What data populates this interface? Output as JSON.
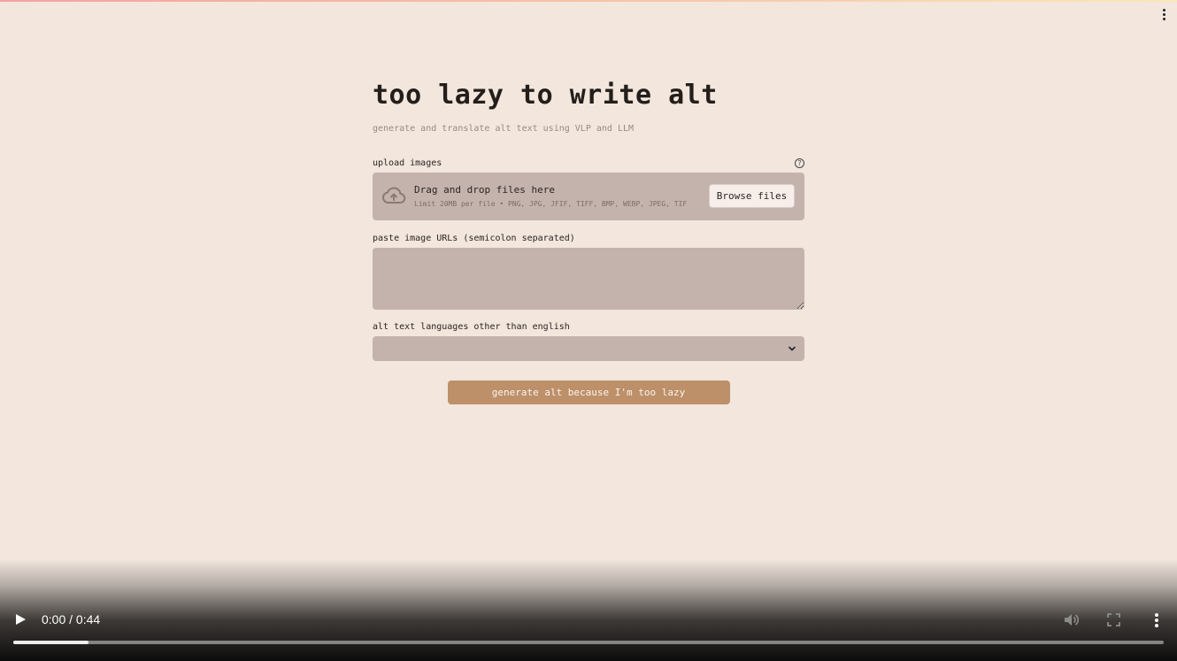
{
  "app": {
    "title": "too lazy to write alt",
    "subtitle": "generate and translate alt text using VLP and LLM"
  },
  "upload": {
    "label": "upload images",
    "help_icon": "help-circle-icon",
    "help_glyph": "?",
    "dropzone_title": "Drag and drop files here",
    "dropzone_limit": "Limit 20MB per file • PNG, JPG, JFIF, TIFF, BMP, WEBP, JPEG, TIF",
    "browse_label": "Browse files",
    "upload_icon": "cloud-upload-icon"
  },
  "urls": {
    "label": "paste image URLs (semicolon separated)",
    "value": ""
  },
  "languages": {
    "label": "alt text languages other than english",
    "selected": "",
    "chevron_icon": "chevron-down-icon"
  },
  "generate_button": {
    "label": "generate alt because I'm too lazy"
  },
  "video_player": {
    "time": "0:00 / 0:44",
    "progress_buffered_fraction": 0.065,
    "progress_played_fraction": 0,
    "icons": [
      "play-icon",
      "volume-icon",
      "fullscreen-icon",
      "more-vert-icon"
    ]
  },
  "colors": {
    "background": "#f2e6dd",
    "input_bg": "#c4b3ad",
    "accent_button": "#bd9069"
  }
}
